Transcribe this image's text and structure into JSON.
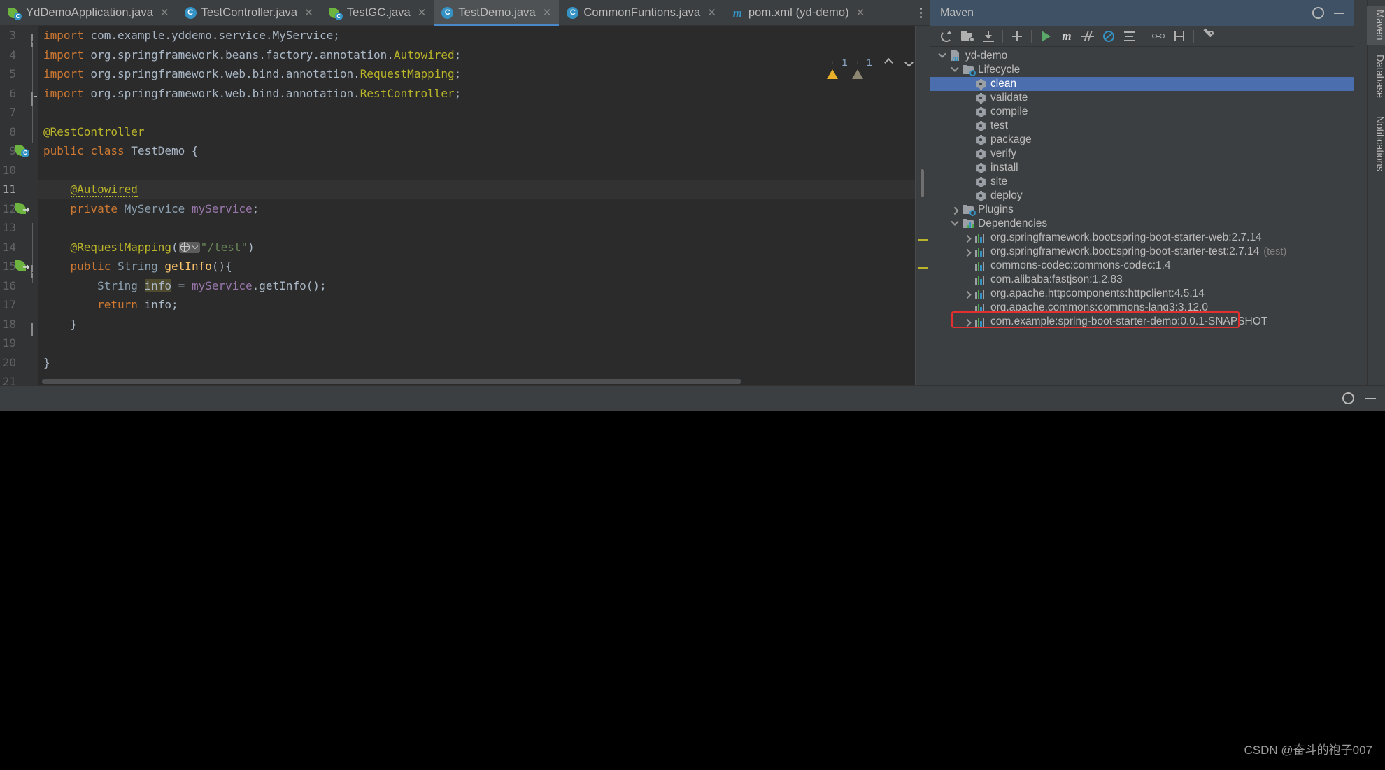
{
  "editor": {
    "tabs": [
      {
        "label": "YdDemoApplication.java",
        "icon": "springboot-class-icon",
        "active": false,
        "closable": true
      },
      {
        "label": "TestController.java",
        "icon": "java-class-icon",
        "active": false,
        "closable": true
      },
      {
        "label": "TestGC.java",
        "icon": "springboot-class-icon",
        "active": false,
        "closable": true
      },
      {
        "label": "TestDemo.java",
        "icon": "java-class-icon",
        "active": true,
        "closable": true
      },
      {
        "label": "CommonFuntions.java",
        "icon": "java-class-icon",
        "active": false,
        "closable": true
      },
      {
        "label": "pom.xml (yd-demo)",
        "icon": "maven-icon",
        "active": false,
        "closable": true
      }
    ],
    "overflow_label": "⋮",
    "status": {
      "warning_count": "1",
      "weak_warning_count": "1",
      "prev_label": "^",
      "next_label": "v"
    },
    "lines": [
      {
        "num": "3",
        "fold": "end-top",
        "gutter_icon": "none",
        "highlight": false
      },
      {
        "num": "4",
        "fold": "none",
        "gutter_icon": "none",
        "highlight": false
      },
      {
        "num": "5",
        "fold": "none",
        "gutter_icon": "none",
        "highlight": false
      },
      {
        "num": "6",
        "fold": "end-bot",
        "gutter_icon": "none",
        "highlight": false
      },
      {
        "num": "7",
        "fold": "none",
        "gutter_icon": "none",
        "highlight": false
      },
      {
        "num": "8",
        "fold": "none",
        "gutter_icon": "none",
        "highlight": false
      },
      {
        "num": "9",
        "fold": "none",
        "gutter_icon": "spring-bean-icon",
        "highlight": false
      },
      {
        "num": "10",
        "fold": "none",
        "gutter_icon": "none",
        "highlight": false
      },
      {
        "num": "11",
        "fold": "none",
        "gutter_icon": "none",
        "highlight": true
      },
      {
        "num": "12",
        "fold": "none",
        "gutter_icon": "spring-autowire-icon",
        "highlight": false
      },
      {
        "num": "13",
        "fold": "none",
        "gutter_icon": "none",
        "highlight": false
      },
      {
        "num": "14",
        "fold": "none",
        "gutter_icon": "none",
        "highlight": false
      },
      {
        "num": "15",
        "fold": "method",
        "gutter_icon": "spring-url-icon",
        "highlight": false
      },
      {
        "num": "16",
        "fold": "none",
        "gutter_icon": "none",
        "highlight": false
      },
      {
        "num": "17",
        "fold": "none",
        "gutter_icon": "none",
        "highlight": false
      },
      {
        "num": "18",
        "fold": "end-bot",
        "gutter_icon": "none",
        "highlight": false
      },
      {
        "num": "19",
        "fold": "none",
        "gutter_icon": "none",
        "highlight": false
      },
      {
        "num": "20",
        "fold": "none",
        "gutter_icon": "none",
        "highlight": false
      },
      {
        "num": "21",
        "fold": "none",
        "gutter_icon": "none",
        "highlight": false
      }
    ],
    "code_text": [
      "import com.example.yddemo.service.MyService;",
      "import org.springframework.beans.factory.annotation.Autowired;",
      "import org.springframework.web.bind.annotation.RequestMapping;",
      "import org.springframework.web.bind.annotation.RestController;",
      "",
      "@RestController",
      "public class TestDemo {",
      "",
      "    @Autowired",
      "    private MyService myService;",
      "",
      "    @RequestMapping(\"/test\")",
      "    public String getInfo(){",
      "        String info = myService.getInfo();",
      "        return info;",
      "    }",
      "",
      "}",
      ""
    ]
  },
  "maven": {
    "title": "Maven",
    "header_actions": [
      {
        "name": "settings-gear-icon",
        "label": ""
      },
      {
        "name": "minimize-icon",
        "label": ""
      }
    ],
    "toolbar": [
      {
        "name": "reload-projects-icon",
        "label": "Reload All Maven Projects"
      },
      {
        "name": "add-maven-project-icon",
        "label": "Add Maven Projects"
      },
      {
        "name": "download-sources-icon",
        "label": "Download Sources"
      },
      {
        "name": "add-icon",
        "label": "Add"
      },
      {
        "name": "run-maven-build-icon",
        "label": "Run Maven Build"
      },
      {
        "name": "execute-goal-icon",
        "label": "Execute Maven Goal"
      },
      {
        "name": "toggle-skip-tests-icon",
        "label": "Toggle Skip Tests Mode"
      },
      {
        "name": "toggle-offline-icon",
        "label": "Toggle Offline Mode"
      },
      {
        "name": "collapse-all-icon",
        "label": "Collapse All"
      },
      {
        "name": "show-dependencies-icon",
        "label": "Show Dependencies"
      },
      {
        "name": "expand-icon",
        "label": "Expand"
      },
      {
        "name": "maven-settings-icon",
        "label": "Maven Settings"
      }
    ],
    "tree": [
      {
        "indent": 0,
        "twist": "down",
        "icon": "maven-module-icon",
        "label": "yd-demo",
        "suffix": "",
        "selected": false,
        "boxed": false
      },
      {
        "indent": 1,
        "twist": "down",
        "icon": "lifecycle-folder-icon",
        "label": "Lifecycle",
        "suffix": "",
        "selected": false,
        "boxed": false
      },
      {
        "indent": 2,
        "twist": "none",
        "icon": "maven-goal-icon",
        "label": "clean",
        "suffix": "",
        "selected": true,
        "boxed": false
      },
      {
        "indent": 2,
        "twist": "none",
        "icon": "maven-goal-icon",
        "label": "validate",
        "suffix": "",
        "selected": false,
        "boxed": false
      },
      {
        "indent": 2,
        "twist": "none",
        "icon": "maven-goal-icon",
        "label": "compile",
        "suffix": "",
        "selected": false,
        "boxed": false
      },
      {
        "indent": 2,
        "twist": "none",
        "icon": "maven-goal-icon",
        "label": "test",
        "suffix": "",
        "selected": false,
        "boxed": false
      },
      {
        "indent": 2,
        "twist": "none",
        "icon": "maven-goal-icon",
        "label": "package",
        "suffix": "",
        "selected": false,
        "boxed": false
      },
      {
        "indent": 2,
        "twist": "none",
        "icon": "maven-goal-icon",
        "label": "verify",
        "suffix": "",
        "selected": false,
        "boxed": false
      },
      {
        "indent": 2,
        "twist": "none",
        "icon": "maven-goal-icon",
        "label": "install",
        "suffix": "",
        "selected": false,
        "boxed": false
      },
      {
        "indent": 2,
        "twist": "none",
        "icon": "maven-goal-icon",
        "label": "site",
        "suffix": "",
        "selected": false,
        "boxed": false
      },
      {
        "indent": 2,
        "twist": "none",
        "icon": "maven-goal-icon",
        "label": "deploy",
        "suffix": "",
        "selected": false,
        "boxed": false
      },
      {
        "indent": 1,
        "twist": "right",
        "icon": "plugins-folder-icon",
        "label": "Plugins",
        "suffix": "",
        "selected": false,
        "boxed": false
      },
      {
        "indent": 1,
        "twist": "down",
        "icon": "dependencies-folder-icon",
        "label": "Dependencies",
        "suffix": "",
        "selected": false,
        "boxed": false
      },
      {
        "indent": 2,
        "twist": "right",
        "icon": "dependency-icon",
        "label": "org.springframework.boot:spring-boot-starter-web:2.7.14",
        "suffix": "",
        "selected": false,
        "boxed": false
      },
      {
        "indent": 2,
        "twist": "right",
        "icon": "dependency-icon",
        "label": "org.springframework.boot:spring-boot-starter-test:2.7.14",
        "suffix": "(test)",
        "selected": false,
        "boxed": false
      },
      {
        "indent": 2,
        "twist": "none",
        "icon": "dependency-icon",
        "label": "commons-codec:commons-codec:1.4",
        "suffix": "",
        "selected": false,
        "boxed": false
      },
      {
        "indent": 2,
        "twist": "none",
        "icon": "dependency-icon",
        "label": "com.alibaba:fastjson:1.2.83",
        "suffix": "",
        "selected": false,
        "boxed": false
      },
      {
        "indent": 2,
        "twist": "right",
        "icon": "dependency-icon",
        "label": "org.apache.httpcomponents:httpclient:4.5.14",
        "suffix": "",
        "selected": false,
        "boxed": false
      },
      {
        "indent": 2,
        "twist": "none",
        "icon": "dependency-icon",
        "label": "org.apache.commons:commons-lang3:3.12.0",
        "suffix": "",
        "selected": false,
        "boxed": false
      },
      {
        "indent": 2,
        "twist": "right",
        "icon": "dependency-icon",
        "label": "com.example:spring-boot-starter-demo:0.0.1-SNAPSHOT",
        "suffix": "",
        "selected": false,
        "boxed": true
      }
    ]
  },
  "right_strip": {
    "tabs": [
      {
        "label": "Maven",
        "selected": true
      },
      {
        "label": "Database",
        "selected": false
      },
      {
        "label": "Notifications",
        "selected": false
      }
    ]
  },
  "bottom_panel": {
    "left_label": "",
    "actions": [
      {
        "name": "settings-gear-icon"
      },
      {
        "name": "minimize-icon"
      }
    ]
  },
  "watermark": "CSDN @奋斗的袍子007",
  "colors": {
    "accent_selection": "#4b6eaf",
    "panel_header": "#3f5165",
    "editor_bg": "#2b2b2b",
    "chrome_bg": "#3c3f41",
    "highlight_box": "#e03030",
    "spring_green": "#6db33f",
    "icon_blue": "#3592c4"
  }
}
